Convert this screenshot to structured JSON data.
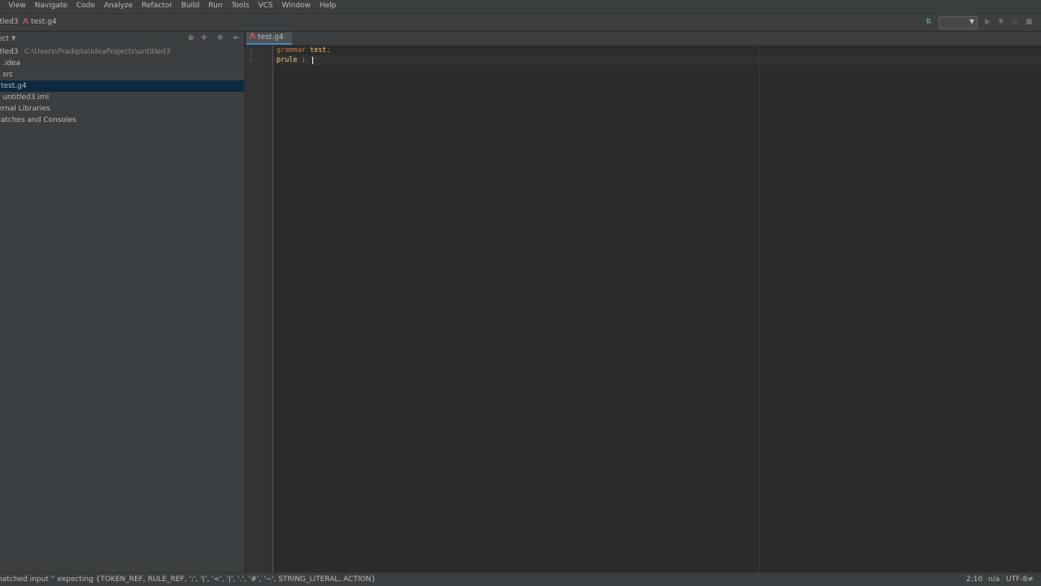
{
  "menu": [
    "t",
    "View",
    "Navigate",
    "Code",
    "Analyze",
    "Refactor",
    "Build",
    "Run",
    "Tools",
    "VCS",
    "Window",
    "Help"
  ],
  "navbar": {
    "project_crumb": "itled3",
    "file_crumb": "test.g4"
  },
  "project_panel": {
    "title": "ect",
    "tree": [
      {
        "label": "itled3",
        "path": "C:\\Users\\Pradipta\\IdeaProjects\\untitled3"
      },
      {
        "label": ".idea"
      },
      {
        "label": "src"
      },
      {
        "label": "test.g4",
        "selected": true
      },
      {
        "label": "untitled3.iml"
      },
      {
        "label": "ernal Libraries"
      },
      {
        "label": "ratches and Consoles"
      }
    ]
  },
  "editor": {
    "tab_label": "test.g4",
    "line_numbers": [
      "1",
      "2"
    ],
    "lines": [
      {
        "k": "grammar",
        "n": "test",
        "p": ";"
      },
      {
        "n": "prule",
        "p": " : ",
        "s": "'"
      }
    ]
  },
  "statusbar": {
    "message": "matched input '' expecting {TOKEN_REF, RULE_REF, ';', '(', '<', '|', '.', '#', '~', STRING_LITERAL, ACTION}",
    "position": "2:10",
    "na": "n/a",
    "encoding": "UTF-8≠"
  },
  "colors": {
    "keyword": "#cc7832",
    "identifier": "#ffc66d",
    "selection": "#0d293e",
    "antlr_icon": "#e0545a"
  }
}
